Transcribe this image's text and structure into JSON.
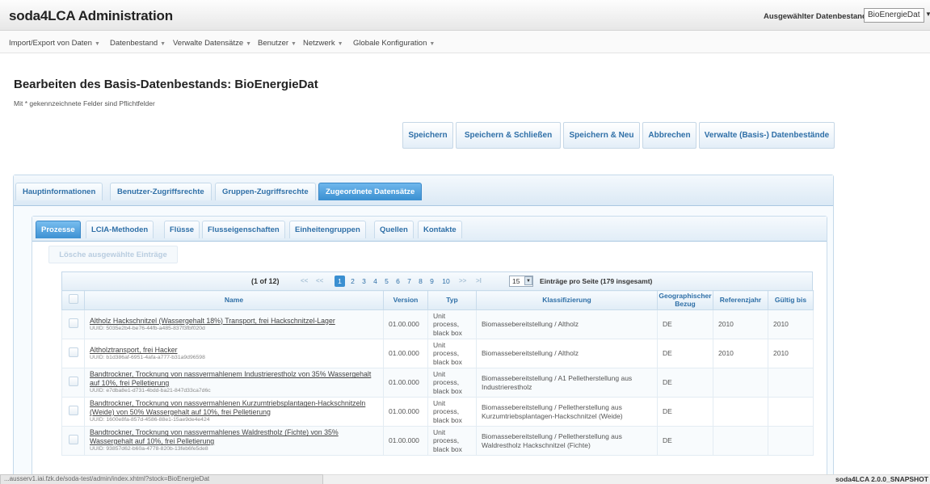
{
  "header": {
    "title": "soda4LCA Administration",
    "datastock_label": "Ausgewählter Datenbestand:",
    "datastock_value": "BioEnergieDat"
  },
  "menu": [
    {
      "label": "Import/Export von Daten"
    },
    {
      "label": "Datenbestand"
    },
    {
      "label": "Verwalte Datensätze"
    },
    {
      "label": "Benutzer"
    },
    {
      "label": "Netzwerk"
    },
    {
      "label": "Globale Konfiguration"
    }
  ],
  "page": {
    "title": "Bearbeiten des Basis-Datenbestands: BioEnergieDat",
    "required_note": "Mit * gekennzeichnete Felder sind Pflichtfelder"
  },
  "actions": [
    {
      "label": "Speichern"
    },
    {
      "label": "Speichern & Schließen"
    },
    {
      "label": "Speichern & Neu"
    },
    {
      "label": "Abbrechen"
    },
    {
      "label": "Verwalte (Basis-) Datenbestände"
    }
  ],
  "outer_tabs": [
    {
      "label": "Hauptinformationen"
    },
    {
      "label": "Benutzer-Zugriffsrechte"
    },
    {
      "label": "Gruppen-Zugriffsrechte"
    },
    {
      "label": "Zugeordnete Datensätze",
      "active": true
    }
  ],
  "inner_tabs": [
    {
      "label": "Prozesse",
      "active": true
    },
    {
      "label": "LCIA-Methoden"
    },
    {
      "label": "Flüsse"
    },
    {
      "label": "Flusseigenschaften"
    },
    {
      "label": "Einheitengruppen"
    },
    {
      "label": "Quellen"
    },
    {
      "label": "Kontakte"
    }
  ],
  "delete_button": "Lösche ausgewählte Einträge",
  "pager": {
    "info": "(1 of 12)",
    "first": "<<",
    "prev": "<<",
    "pages": [
      "1",
      "2",
      "3",
      "4",
      "5",
      "6",
      "7",
      "8",
      "9",
      "10"
    ],
    "current": "1",
    "next": ">>",
    "last": ">I",
    "rows_per_page": "15",
    "summary": "Einträge pro Seite (179 insgesamt)"
  },
  "table": {
    "headers": [
      "",
      "Name",
      "Version",
      "Typ",
      "Klassifizierung",
      "Geographischer Bezug",
      "Referenzjahr",
      "Gültig bis"
    ],
    "rows": [
      {
        "name": "Altholz Hackschnitzel (Wassergehalt 18%) Transport, frei Hackschnitzel-Lager",
        "uuid": "UUID: 5035e2b4-be76-44fb-a485-837f3fbf020d",
        "version": "01.00.000",
        "type": "Unit process, black box",
        "classification": "Biomassebereitstellung / Altholz",
        "geo": "DE",
        "refyear": "2010",
        "valid": "2010"
      },
      {
        "name": "Altholztransport, frei Hacker",
        "uuid": "UUID: b1d386af-6951-4afa-a777-b31a9d96598",
        "version": "01.00.000",
        "type": "Unit process, black box",
        "classification": "Biomassebereitstellung / Altholz",
        "geo": "DE",
        "refyear": "2010",
        "valid": "2010"
      },
      {
        "name": "Bandtrockner, Trocknung von nassvermahlenem Industrierestholz von 35% Wassergehalt auf 10%, frei Pelletierung",
        "uuid": "UUID: e7dba8e1-d731-4bdd-ba21-847d33ca7d6c",
        "version": "01.00.000",
        "type": "Unit process, black box",
        "classification": "Biomassebereitstellung / A1 Pelletherstellung aus Industrierestholz",
        "geo": "DE",
        "refyear": "",
        "valid": ""
      },
      {
        "name": "Bandtrockner, Trocknung von nassvermahlenen Kurzumtriebsplantagen-Hackschnitzeln (Weide) von 50% Wassergehalt auf 10%, frei Pelletierung",
        "uuid": "UUID: 1600e8fa-857d-4586-88e1-15ae9de4e424",
        "version": "01.00.000",
        "type": "Unit process, black box",
        "classification": "Biomassebereitstellung / Pelletherstellung aus Kurzumtriebsplantagen-Hackschnitzel (Weide)",
        "geo": "DE",
        "refyear": "",
        "valid": ""
      },
      {
        "name": "Bandtrockner, Trocknung von nassvermahlenes Waldrestholz (Fichte) von 35% Wassergehalt auf 10%, frei Pelletierung",
        "uuid": "UUID: 93857d62-b60a-4778-820b-13feb6fe5de8",
        "version": "01.00.000",
        "type": "Unit process, black box",
        "classification": "Biomassebereitstellung / Pelletherstellung aus Waldrestholz Hackschnitzel (Fichte)",
        "geo": "DE",
        "refyear": "",
        "valid": ""
      }
    ]
  },
  "status": {
    "url": "...ausserv1.iai.fzk.de/soda-test/admin/index.xhtml?stock=BioEnergieDat",
    "version": "soda4LCA 2.0.0_SNAPSHOT"
  }
}
